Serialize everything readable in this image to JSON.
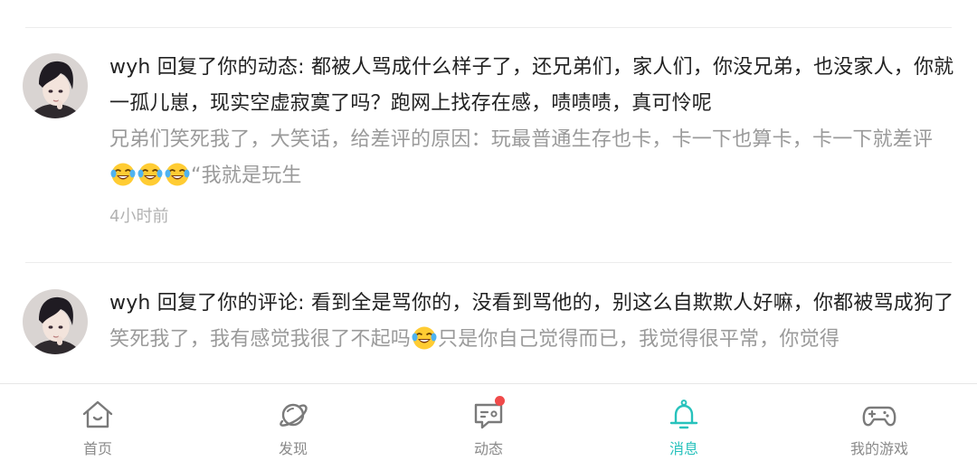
{
  "messages": [
    {
      "user": "wyh",
      "action": " 回复了你的动态: ",
      "content": "都被人骂成什么样子了，还兄弟们，家人们，你没兄弟，也没家人，你就一孤儿崽，现实空虚寂寞了吗？跑网上找存在感，啧啧啧，真可怜呢",
      "quote": "兄弟们笑死我了，大笑话，给差评的原因：玩最普通生存也卡，卡一下也算卡，卡一下就差评",
      "quote_tail": "“我就是玩生",
      "quote_emoji": [
        "laughing-tears",
        "laughing-tears",
        "laughing-tears"
      ],
      "time": "4小时前"
    },
    {
      "user": "wyh",
      "action": " 回复了你的评论: ",
      "content": "看到全是骂你的，没看到骂他的，别这么自欺欺人好嘛，你都被骂成狗了",
      "quote": "笑死我了，我有感觉我很了不起吗",
      "quote_tail": "只是你自己觉得而已，我觉得很平常，你觉得",
      "quote_emoji": [
        "laughing-tears"
      ]
    }
  ],
  "tabbar": {
    "items": [
      {
        "label": "首页",
        "icon": "home-icon",
        "active": false
      },
      {
        "label": "发现",
        "icon": "planet-icon",
        "active": false
      },
      {
        "label": "动态",
        "icon": "message-icon",
        "active": false,
        "badge": true
      },
      {
        "label": "消息",
        "icon": "bell-icon",
        "active": true
      },
      {
        "label": "我的游戏",
        "icon": "gamepad-icon",
        "active": false
      }
    ]
  },
  "colors": {
    "accent": "#27c2bc",
    "text": "#222222",
    "quote": "#9a9a9a",
    "time": "#b2b2b2",
    "inactive_tab": "#8a8a8a",
    "badge": "#f04a4a"
  }
}
